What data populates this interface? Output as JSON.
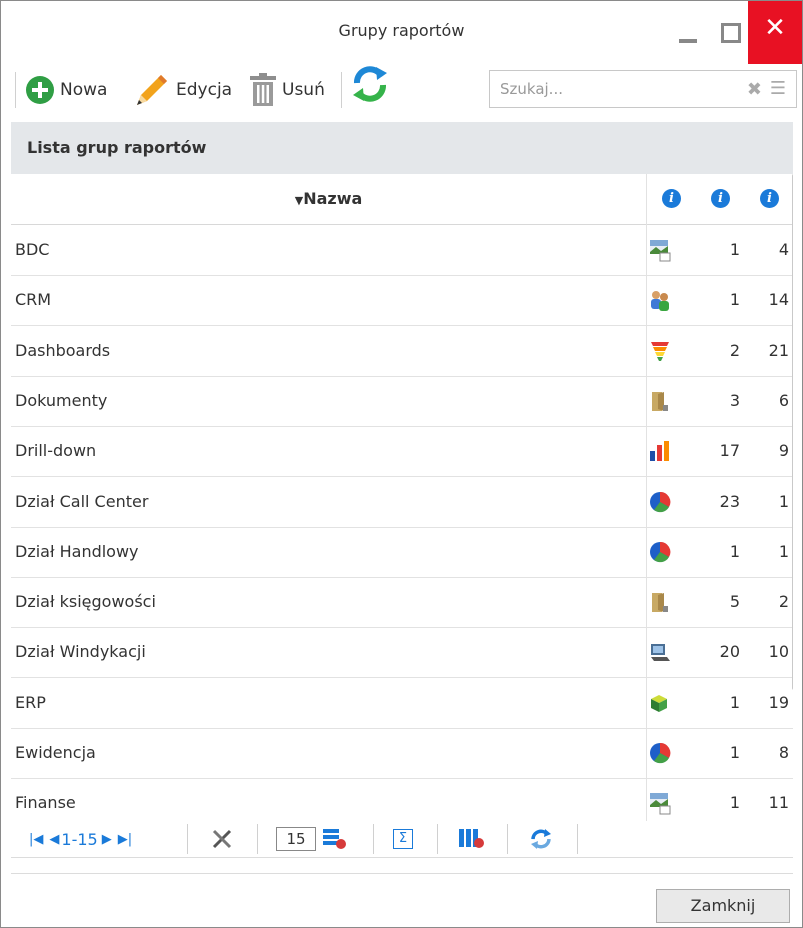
{
  "window": {
    "title": "Grupy raportów"
  },
  "toolbar": {
    "new_label": "Nowa",
    "edit_label": "Edycja",
    "delete_label": "Usuń"
  },
  "search": {
    "placeholder": "Szukaj..."
  },
  "section": {
    "title": "Lista grup raportów"
  },
  "grid": {
    "columns": {
      "name": "Nazwa",
      "sort": "descending"
    },
    "rows": [
      {
        "name": "BDC",
        "icon": "image-icon",
        "c1": "1",
        "c2": "4"
      },
      {
        "name": "CRM",
        "icon": "users-icon",
        "c1": "1",
        "c2": "14"
      },
      {
        "name": "Dashboards",
        "icon": "funnel-icon",
        "c1": "2",
        "c2": "21"
      },
      {
        "name": "Dokumenty",
        "icon": "folder-icon",
        "c1": "3",
        "c2": "6"
      },
      {
        "name": "Drill-down",
        "icon": "bar-chart-icon",
        "c1": "17",
        "c2": "9"
      },
      {
        "name": "Dział Call Center",
        "icon": "pie-chart-icon",
        "c1": "23",
        "c2": "1"
      },
      {
        "name": "Dział Handlowy",
        "icon": "pie-chart-icon",
        "c1": "1",
        "c2": "1"
      },
      {
        "name": "Dział księgowości",
        "icon": "folder-icon",
        "c1": "5",
        "c2": "2"
      },
      {
        "name": "Dział Windykacji",
        "icon": "computer-icon",
        "c1": "20",
        "c2": "10"
      },
      {
        "name": "ERP",
        "icon": "cubes-icon",
        "c1": "1",
        "c2": "19"
      },
      {
        "name": "Ewidencja",
        "icon": "pie-chart-icon",
        "c1": "1",
        "c2": "8"
      },
      {
        "name": "Finanse",
        "icon": "image-icon",
        "c1": "1",
        "c2": "11"
      }
    ]
  },
  "pager": {
    "range": "1-15",
    "page_size": "15"
  },
  "footer": {
    "close_label": "Zamknij"
  }
}
